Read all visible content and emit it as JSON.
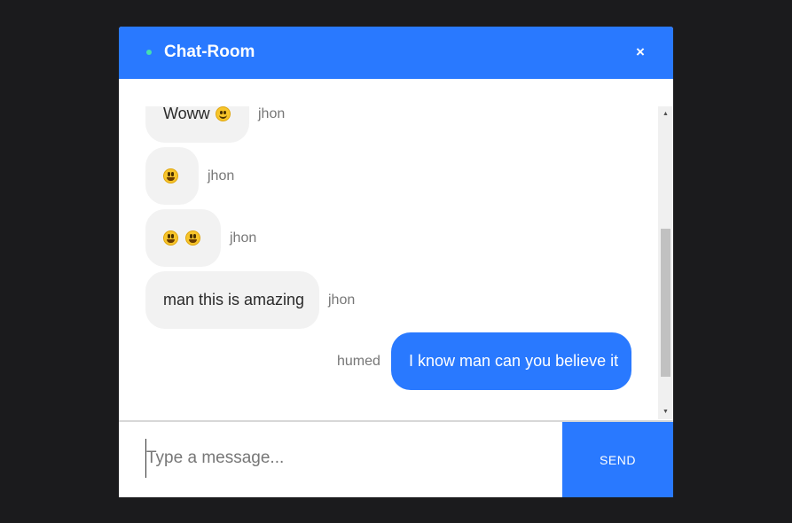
{
  "header": {
    "title": "Chat-Room",
    "close_label": "×",
    "status_icon": "online-dot-icon"
  },
  "messages": [
    {
      "direction": "incoming",
      "sender": "jhon",
      "text": "Woww",
      "emojis": [
        "slightly-smiling-face"
      ]
    },
    {
      "direction": "incoming",
      "sender": "jhon",
      "text": "",
      "emojis": [
        "grinning-face"
      ]
    },
    {
      "direction": "incoming",
      "sender": "jhon",
      "text": "",
      "emojis": [
        "grinning-face",
        "grinning-face"
      ]
    },
    {
      "direction": "incoming",
      "sender": "jhon",
      "text": "man this is amazing",
      "emojis": []
    },
    {
      "direction": "outgoing",
      "sender": "humed",
      "text": "I know man can you believe it",
      "emojis": []
    }
  ],
  "composer": {
    "placeholder": "Type a message...",
    "value": "",
    "send_label": "SEND"
  },
  "colors": {
    "accent": "#2979ff",
    "background": "#1b1b1d",
    "incoming_bubble": "#f2f2f2",
    "status_dot": "#45e0b0"
  }
}
